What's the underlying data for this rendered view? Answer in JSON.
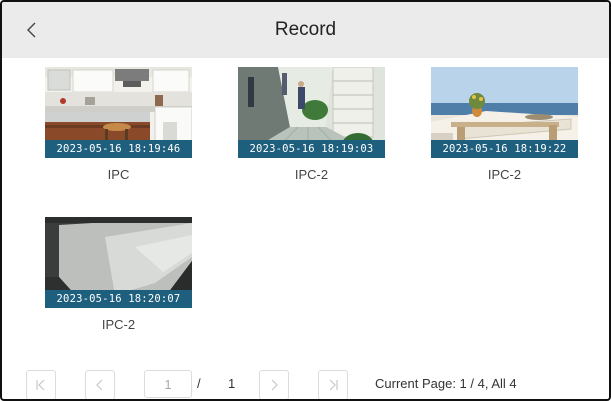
{
  "header": {
    "title": "Record",
    "back_icon": "chevron-left-icon"
  },
  "records": [
    {
      "camera": "IPC",
      "timestamp": "2023-05-16 18:19:46",
      "scene": "kitchen"
    },
    {
      "camera": "IPC-2",
      "timestamp": "2023-05-16 18:19:03",
      "scene": "hallway"
    },
    {
      "camera": "IPC-2",
      "timestamp": "2023-05-16 18:19:22",
      "scene": "patio"
    },
    {
      "camera": "IPC-2",
      "timestamp": "2023-05-16 18:20:07",
      "scene": "ceiling"
    }
  ],
  "pagination": {
    "current_page_value": "1",
    "separator": "/",
    "total_pages": "1",
    "summary": "Current Page: 1 / 4, All 4",
    "icons": [
      "first-page-icon",
      "prev-page-icon",
      "next-page-icon",
      "last-page-icon"
    ]
  },
  "colors": {
    "header_bg": "#ebebeb",
    "timestamp_bar": "#1f5f7e"
  }
}
